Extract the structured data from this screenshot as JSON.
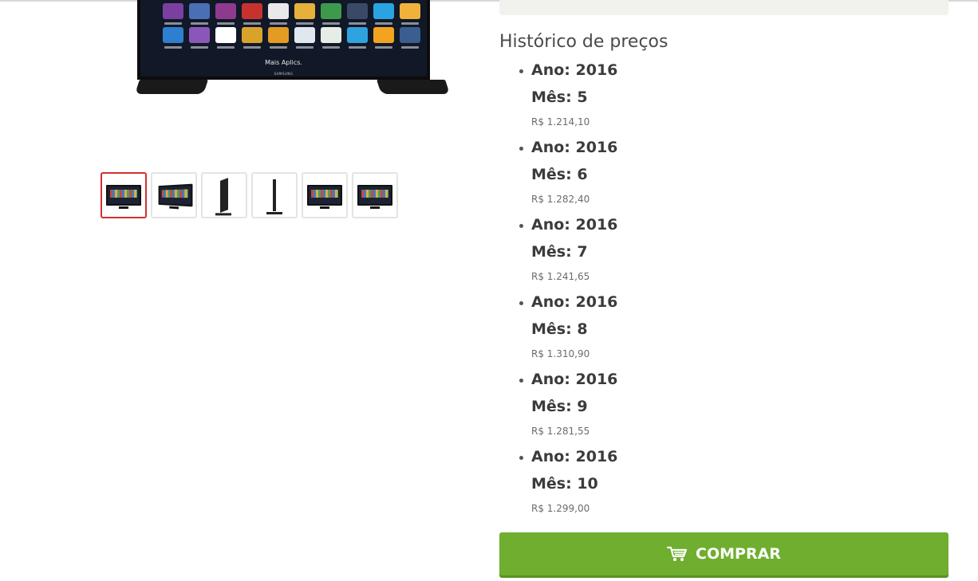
{
  "product_image": {
    "tv_screen_caption": "Mais Aplics.",
    "tv_brand": "SAMSUNG"
  },
  "thumbnails": [
    {
      "label": "thumbnail-front",
      "kind": "front",
      "active": true
    },
    {
      "label": "thumbnail-angled",
      "kind": "front",
      "active": false
    },
    {
      "label": "thumbnail-side-angled",
      "kind": "side",
      "active": false
    },
    {
      "label": "thumbnail-side",
      "kind": "slim",
      "active": false
    },
    {
      "label": "thumbnail-front-2",
      "kind": "front",
      "active": false
    },
    {
      "label": "thumbnail-front-3",
      "kind": "front",
      "active": false
    }
  ],
  "history": {
    "title": "Histórico de preços",
    "year_prefix": "Ano: ",
    "month_prefix": "Mês: ",
    "entries": [
      {
        "year": "2016",
        "month": "5",
        "price": "R$ 1.214,10"
      },
      {
        "year": "2016",
        "month": "6",
        "price": "R$ 1.282,40"
      },
      {
        "year": "2016",
        "month": "7",
        "price": "R$ 1.241,65"
      },
      {
        "year": "2016",
        "month": "8",
        "price": "R$ 1.310,90"
      },
      {
        "year": "2016",
        "month": "9",
        "price": "R$ 1.281,55"
      },
      {
        "year": "2016",
        "month": "10",
        "price": "R$ 1.299,00"
      }
    ]
  },
  "buy_button": {
    "label": "COMPRAR",
    "icon": "cart-icon"
  },
  "colors": {
    "accent_green": "#6fae2e",
    "active_thumb_border": "#d0302f"
  }
}
